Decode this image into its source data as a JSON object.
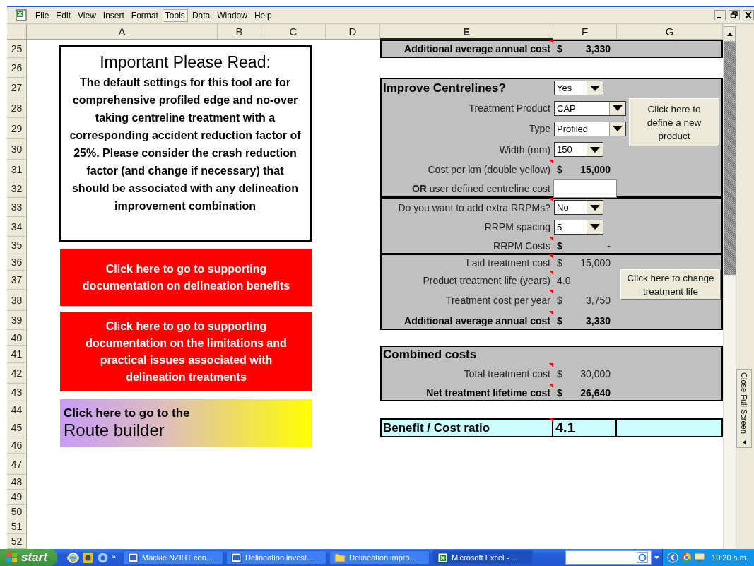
{
  "menu": [
    {
      "label": "File",
      "selected": false
    },
    {
      "label": "Edit",
      "selected": false
    },
    {
      "label": "View",
      "selected": false
    },
    {
      "label": "Insert",
      "selected": false
    },
    {
      "label": "Format",
      "selected": false
    },
    {
      "label": "Tools",
      "selected": true
    },
    {
      "label": "Data",
      "selected": false
    },
    {
      "label": "Window",
      "selected": false
    },
    {
      "label": "Help",
      "selected": false
    }
  ],
  "columns": [
    {
      "label": "A",
      "selected": false
    },
    {
      "label": "B",
      "selected": false
    },
    {
      "label": "C",
      "selected": false
    },
    {
      "label": "D",
      "selected": false
    },
    {
      "label": "E",
      "selected": true
    },
    {
      "label": "F",
      "selected": false
    },
    {
      "label": "G",
      "selected": false
    }
  ],
  "rows": [
    "25",
    "26",
    "27",
    "28",
    "29",
    "30",
    "31",
    "32",
    "33",
    "34",
    "35",
    "36",
    "37",
    "38",
    "39",
    "40",
    "41",
    "42",
    "43",
    "44",
    "45",
    "46",
    "47",
    "48",
    "49",
    "50",
    "51",
    "52"
  ],
  "notice": {
    "title": "Important Please Read:",
    "body": "The default settings for this tool are for comprehensive profiled edge and no-over taking centreline treatment with a corresponding accident reduction factor of 25%.  Please consider the crash reduction factor (and change if necessary) that should be associated with any delineation improvement combination"
  },
  "link_buttons": [
    {
      "kind": "red",
      "lines": [
        "Click here to go to supporting documentation on delineation benefits"
      ]
    },
    {
      "kind": "red",
      "lines": [
        "Click here to go to supporting documentation on the limitations and practical issues associated with delineation treatments"
      ]
    },
    {
      "kind": "gradient",
      "lines": [
        "Click here to go to the",
        "Route builder"
      ]
    }
  ],
  "sections": [
    {
      "lines": [
        {
          "kind": "amount",
          "label": "Additional average annual cost",
          "currency": "$",
          "value": "3,330",
          "label_bold": true,
          "value_bold": true,
          "comment": true
        }
      ]
    },
    {
      "lines": [
        {
          "kind": "title",
          "label": "Improve Centrelines?",
          "value": "Yes",
          "comment": false
        },
        {
          "kind": "dropdown",
          "label": "Treatment Product",
          "value": "CAP",
          "comment": false
        },
        {
          "kind": "dropdown",
          "label": "Type",
          "value": "Profiled",
          "comment": false
        },
        {
          "kind": "dropdown",
          "label": "Width (mm)",
          "value": "150",
          "comment": false
        },
        {
          "kind": "amount",
          "label": "Cost per km (double yellow)",
          "currency": "$",
          "value": "15,000",
          "label_bold": false,
          "value_bold": true,
          "comment": true
        },
        {
          "kind": "input",
          "label": "**OR** user defined centreline cost",
          "comment": false
        }
      ],
      "button": "Click here to define a new product"
    },
    {
      "lines": [
        {
          "kind": "dropdown",
          "label": "Do you want to add extra RRPMs?",
          "value": "No",
          "comment": true
        },
        {
          "kind": "dropdown",
          "label": "RRPM spacing",
          "value": "5",
          "comment": false
        },
        {
          "kind": "amount",
          "label": "RRPM Costs",
          "currency": "$",
          "value": "-",
          "label_bold": false,
          "value_bold": true,
          "comment": true
        }
      ]
    },
    {
      "lines": [
        {
          "kind": "amount",
          "label": "Laid treatment cost",
          "currency": "$",
          "value": "15,000",
          "label_bold": false,
          "value_bold": false,
          "comment": true
        },
        {
          "kind": "amount",
          "label": "Product treatment life (years)",
          "value": "4.0",
          "label_bold": false,
          "value_bold": false,
          "comment": true
        },
        {
          "kind": "amount",
          "label": "Treatment cost per year",
          "currency": "$",
          "value": "3,750",
          "label_bold": false,
          "value_bold": false,
          "comment": true
        },
        {
          "kind": "amount",
          "label": "Additional average annual cost",
          "currency": "$",
          "value": "3,330",
          "label_bold": true,
          "value_bold": true,
          "comment": true
        }
      ],
      "button": "Click here to change treatment life"
    },
    {
      "lines": [
        {
          "kind": "title",
          "label": "Combined costs",
          "comment": false
        },
        {
          "kind": "amount",
          "label": "Total treatment cost",
          "currency": "$",
          "value": "30,000",
          "label_bold": false,
          "value_bold": false,
          "comment": true
        },
        {
          "kind": "amount",
          "label": "Net treatment lifetime cost",
          "currency": "$",
          "value": "26,640",
          "label_bold": true,
          "value_bold": true,
          "comment": true
        }
      ]
    },
    {
      "lines": [
        {
          "kind": "ratio",
          "label": "Benefit / Cost ratio",
          "value": "4.1",
          "comment": true
        }
      ]
    }
  ],
  "side_panel": {
    "button": "Close Full Screen"
  },
  "taskbar": {
    "start": "start",
    "more": "»",
    "tasks": [
      {
        "kind": "word",
        "label": "Mackie NZIHT con...",
        "selected": false
      },
      {
        "kind": "word",
        "label": "Delineation invest...",
        "selected": false
      },
      {
        "kind": "folder",
        "label": "Delineation impro...",
        "selected": false
      },
      {
        "kind": "excel",
        "label": "Microsoft Excel - ...",
        "selected": true
      }
    ],
    "clock": "10:20 a.m."
  }
}
